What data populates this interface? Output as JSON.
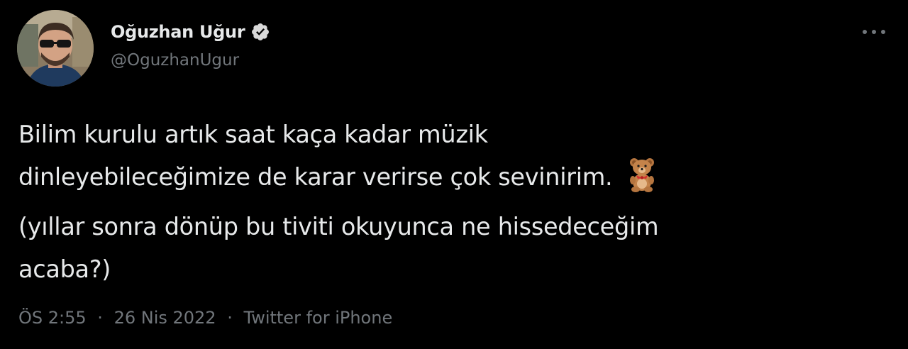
{
  "author": {
    "display_name": "Oğuzhan Uğur",
    "handle": "@OguzhanUgur",
    "verified": true,
    "avatar": "profile-photo"
  },
  "tweet": {
    "lines": [
      "Bilim kurulu artık saat kaça kadar müzik",
      "dinleyebileceğimize de karar verirse çok sevinirim.",
      "(yıllar sonra dönüp bu tiviti okuyunca ne hissedeceğim",
      "acaba?)"
    ],
    "emoji": "teddy-bear"
  },
  "meta": {
    "time": "ÖS 2:55",
    "date": "26 Nis 2022",
    "source": "Twitter for iPhone",
    "separator": "·"
  },
  "icons": {
    "more": "more-horizontal-icon",
    "verified": "verified-badge-icon"
  },
  "colors": {
    "background": "#000000",
    "primary_text": "#e7e9ea",
    "secondary_text": "#71767b",
    "verified_badge": "#d9d9d9"
  }
}
